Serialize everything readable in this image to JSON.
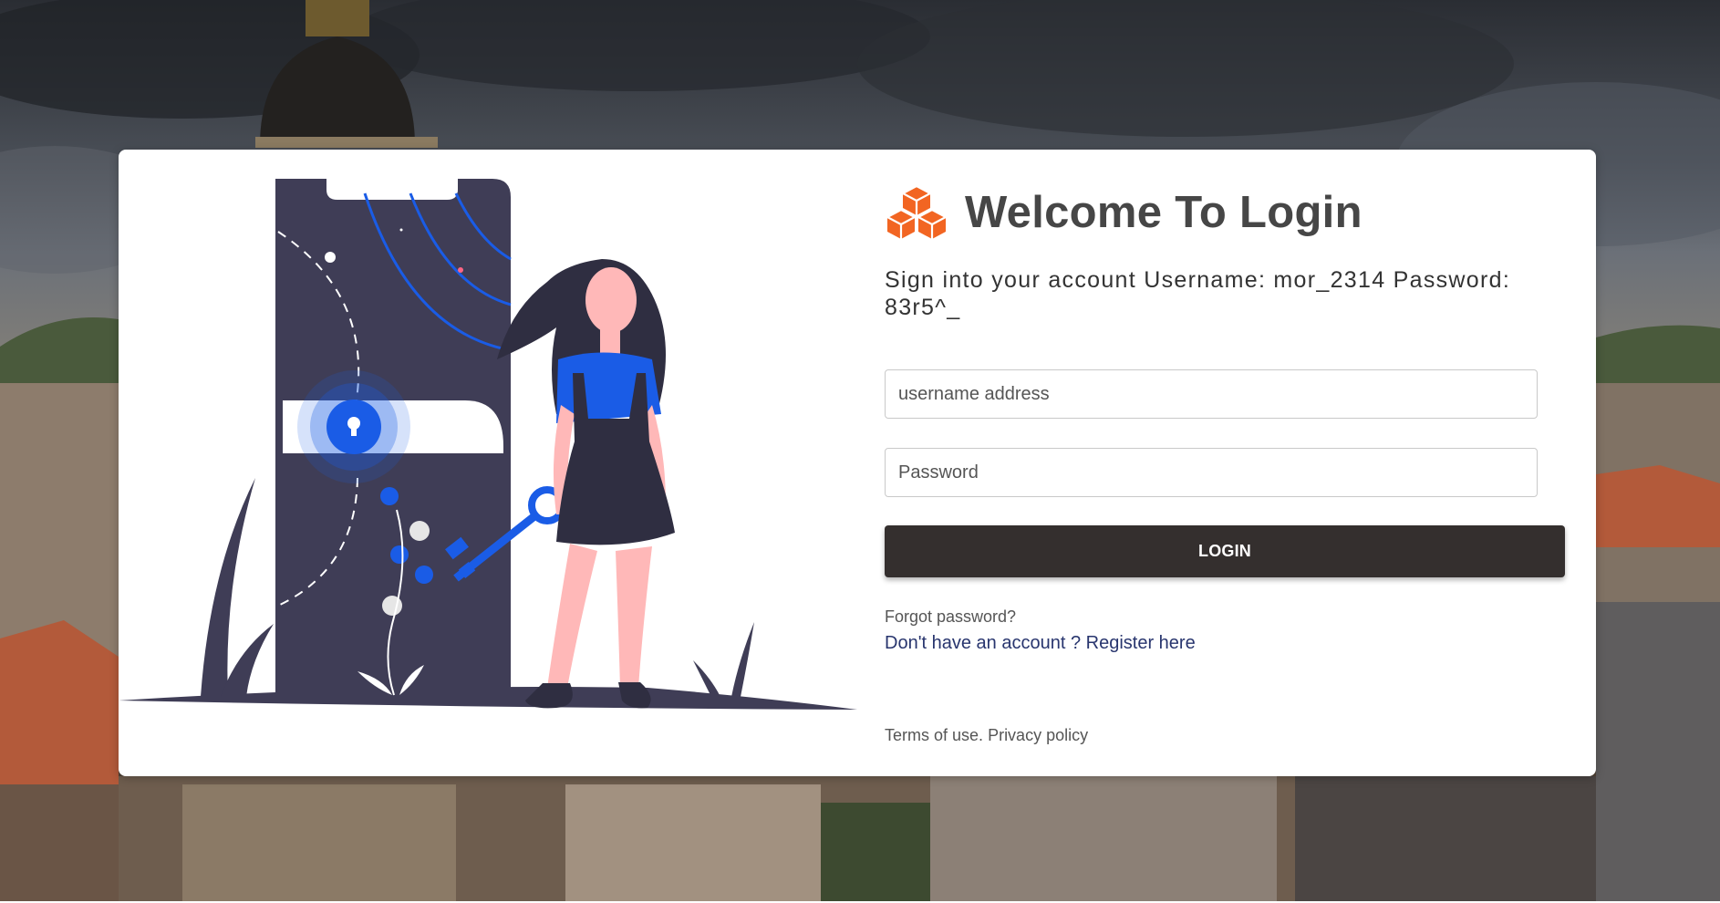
{
  "brand": {
    "logo_icon": "cubes-icon",
    "logo_color": "#f26522",
    "title": "Welcome To Login"
  },
  "subtitle": "Sign into your account Username: mor_2314 Password: 83r5^_",
  "form": {
    "username_placeholder": "username address",
    "password_placeholder": "Password",
    "login_label": "LOGIN",
    "button_color": "#342f2e"
  },
  "links": {
    "forgot_password": "Forgot password?",
    "register": "Don't have an account ? Register here",
    "terms": "Terms of use.",
    "privacy": "Privacy policy"
  },
  "colors": {
    "accent_blue": "#1a5ce6",
    "phone_dark": "#3f3d56",
    "skin_pink": "#ffb8b8"
  }
}
